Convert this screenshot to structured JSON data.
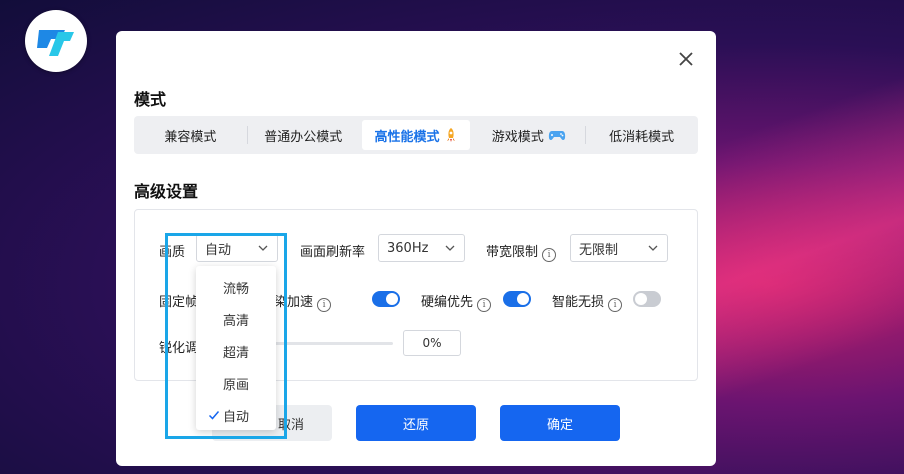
{
  "colors": {
    "accent": "#1566f0",
    "highlight": "#1aa6e8",
    "toggle_off": "#c9ccd2"
  },
  "app_logo": {
    "icon": "app-logo-icon"
  },
  "dialog": {
    "close_icon": "close-icon",
    "mode_section_title": "模式",
    "mode_tabs": [
      {
        "label": "兼容模式",
        "active": false
      },
      {
        "label": "普通办公模式",
        "active": false
      },
      {
        "label": "高性能模式",
        "active": true,
        "icon": "rocket-icon"
      },
      {
        "label": "游戏模式",
        "active": false,
        "icon": "gamepad-icon"
      },
      {
        "label": "低消耗模式",
        "active": false
      }
    ],
    "advanced_section_title": "高级设置",
    "settings": {
      "quality": {
        "label": "画质",
        "value": "自动"
      },
      "refresh_rate": {
        "label": "画面刷新率",
        "value": "360Hz"
      },
      "bandwidth_limit": {
        "label": "带宽限制",
        "value": "无限制"
      },
      "fixed_frame": {
        "label": "固定帧"
      },
      "render_accel": {
        "label": "渲染加速",
        "enabled": true
      },
      "hw_encode": {
        "label": "硬编优先",
        "enabled": true
      },
      "smart_lossless": {
        "label": "智能无损",
        "enabled": false
      },
      "sharpen": {
        "label": "锐化调",
        "value": "0%",
        "level": 0
      }
    },
    "info_glyph": "i",
    "buttons": {
      "cancel": "取消",
      "restore": "还原",
      "confirm": "确定"
    },
    "quality_dropdown": {
      "options": [
        "流畅",
        "高清",
        "超清",
        "原画",
        "自动"
      ],
      "selected": "自动"
    }
  }
}
